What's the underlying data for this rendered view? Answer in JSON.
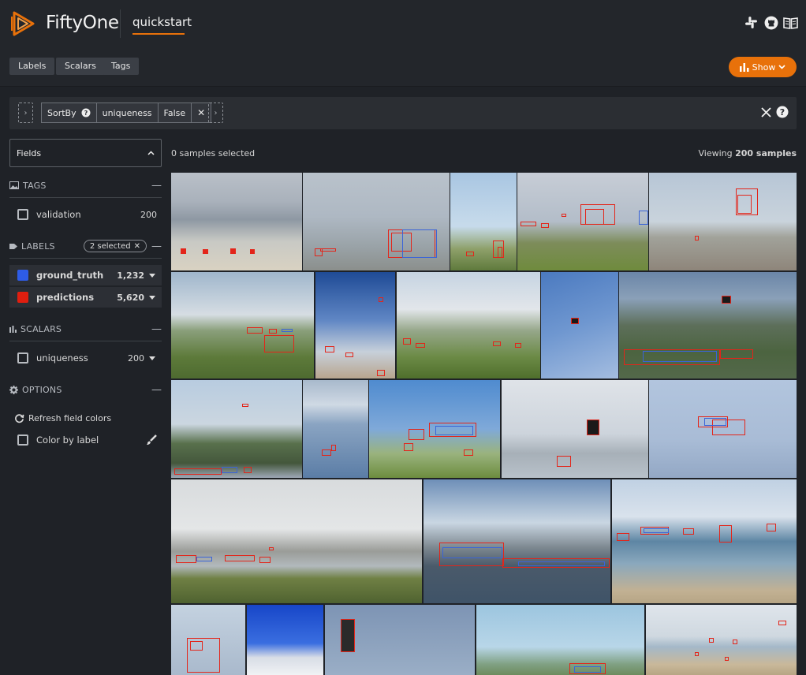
{
  "header": {
    "brand": "FiftyOne",
    "dataset_name": "quickstart",
    "icons": [
      "slack-icon",
      "github-icon",
      "docs-book-icon"
    ]
  },
  "toolbar": {
    "tabs": [
      "Labels",
      "Scalars",
      "Tags"
    ],
    "show_label": "Show"
  },
  "view_bar": {
    "stage_name": "SortBy",
    "stage_field": "uniqueness",
    "stage_reverse": "False"
  },
  "sidebar": {
    "fields_title": "Fields",
    "tags_title": "TAGS",
    "tags": [
      {
        "label": "validation",
        "count": "200"
      }
    ],
    "labels_title": "LABELS",
    "labels_selected": "2 selected",
    "labels": [
      {
        "label": "ground_truth",
        "count": "1,232",
        "color": "#2e5ce6"
      },
      {
        "label": "predictions",
        "count": "5,620",
        "color": "#e01e0f"
      }
    ],
    "scalars_title": "SCALARS",
    "scalars": [
      {
        "label": "uniqueness",
        "count": "200"
      }
    ],
    "options_title": "OPTIONS",
    "refresh_label": "Refresh field colors",
    "color_by_label": "Color by label"
  },
  "main": {
    "selected_text": "0 samples selected",
    "viewing_prefix": "Viewing ",
    "viewing_count": "200 samples"
  },
  "colors": {
    "accent": "#e8710a",
    "ground_truth": "#2e5ce6",
    "predictions": "#e01e0f"
  }
}
